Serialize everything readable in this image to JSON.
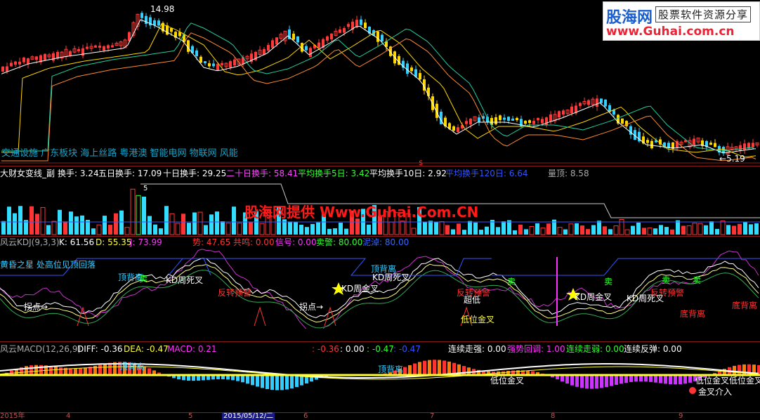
{
  "colors": {
    "up": "#ff3333",
    "down": "#33ccff",
    "gold": "#ffd700",
    "kline_up": "#ff4040",
    "kline_down": "#40e0ff",
    "magenta": "#ff33ff",
    "green": "#33ff33",
    "blue": "#3355ff",
    "yellow": "#ffff33",
    "cyan": "#33ffff"
  },
  "main": {
    "high_label": "14.98",
    "low_label": "5.19",
    "concepts": "交通设施 广东板块 海上丝路 粤港澳 智能电网 物联网 风能",
    "divider_mark": "$"
  },
  "vol": {
    "header": [
      {
        "text": "大财女变线_副",
        "color": "#ffffff"
      },
      {
        "text": "换手: 3.24",
        "color": "#ffffff"
      },
      {
        "text": "五日换手: 17.09",
        "color": "#ffffff"
      },
      {
        "text": "十日换手: 29.25",
        "color": "#ffffff"
      },
      {
        "text": "二十日换手: 58.41",
        "color": "#ff44ff"
      },
      {
        "text": "平均换手5日: 3.42",
        "color": "#33ff33"
      },
      {
        "text": "平均换手10日: 2.92",
        "color": "#ffffff"
      },
      {
        "text": "平均换手120日: 6.64",
        "color": "#3355ff"
      },
      {
        "text": "量顶: 8.58",
        "color": "#aaaaaa"
      }
    ],
    "marker": "5"
  },
  "watermark": "股海网提供 Www.Guhai.Com.CN",
  "logo": {
    "main": "股海网",
    "sub": "股票软件资源分享",
    "url": "www.Guhai.com.cn"
  },
  "kdj": {
    "header": [
      {
        "text": "风云KDJ(9,3,3)",
        "color": "#aaaaaa"
      },
      {
        "text": "K: 61.56",
        "color": "#ffffff"
      },
      {
        "text": "D: 55.35",
        "color": "#ffff33"
      },
      {
        "text": "J: 73.99",
        "color": "#ff33ff"
      },
      {
        "text": "势: 47.65",
        "color": "#ff3333"
      },
      {
        "text": "共鸣: 0.00",
        "color": "#ff3333"
      },
      {
        "text": "信号: 0.00",
        "color": "#ff33ff"
      },
      {
        "text": "卖警: 80.00",
        "color": "#33ff33"
      },
      {
        "text": "泥淖: 80.00",
        "color": "#3366ff"
      }
    ],
    "annotations": [
      {
        "text": "黄昏之星 处高位见顶回落",
        "color": "#33ccff"
      },
      {
        "text": "顶背离",
        "color": "#33ccff"
      },
      {
        "text": "KD周死叉",
        "color": "#ffffff"
      },
      {
        "text": "反转预警",
        "color": "#ff3333"
      },
      {
        "text": "拐点→",
        "color": "#ffffff"
      },
      {
        "text": "卖",
        "color": "#33ff33"
      },
      {
        "text": "顶背离",
        "color": "#33ccff"
      },
      {
        "text": "KD周死叉",
        "color": "#ffffff"
      },
      {
        "text": "KD周金叉",
        "color": "#ffffff"
      },
      {
        "text": "拐点→",
        "color": "#ffffff"
      },
      {
        "text": "超低",
        "color": "#ffffff"
      },
      {
        "text": "反转预警",
        "color": "#ff3333"
      },
      {
        "text": "低位金叉",
        "color": "#ffff33"
      },
      {
        "text": "卖",
        "color": "#33ff33"
      },
      {
        "text": "KD周金叉",
        "color": "#ffffff"
      },
      {
        "text": "卖",
        "color": "#33ff33"
      },
      {
        "text": "KD周死叉",
        "color": "#ffffff"
      },
      {
        "text": "反转预警",
        "color": "#ff3333"
      },
      {
        "text": "卖",
        "color": "#33ff33"
      },
      {
        "text": "卖",
        "color": "#33ff33"
      },
      {
        "text": "底背离",
        "color": "#ff3333"
      },
      {
        "text": "底背离",
        "color": "#ff3333"
      }
    ]
  },
  "macd": {
    "header": [
      {
        "text": "风云MACD(12,26,9)",
        "color": "#aaaaaa"
      },
      {
        "text": "DIFF: -0.36",
        "color": "#ffffff"
      },
      {
        "text": "DEA: -0.47",
        "color": "#ffff33"
      },
      {
        "text": "MACD: 0.21",
        "color": "#ff33ff"
      },
      {
        "text": ": -0.36",
        "color": "#ff3333"
      },
      {
        "text": ": 0.00",
        "color": "#ffffff"
      },
      {
        "text": ": -0.47",
        "color": "#33ff33"
      },
      {
        "text": ": -0.47",
        "color": "#3355ff"
      },
      {
        "text": "连续走强: 0.00",
        "color": "#ffffff"
      },
      {
        "text": "强势回调: 1.00",
        "color": "#ff33ff"
      },
      {
        "text": "连续走弱: 0.00",
        "color": "#33ff33"
      },
      {
        "text": "连续反弹: 0.00",
        "color": "#ffffff"
      }
    ],
    "annotations": [
      {
        "text": "顶背离",
        "color": "#33ccff"
      },
      {
        "text": "顶背离",
        "color": "#33ccff"
      },
      {
        "text": "低位金叉",
        "color": "#ffffff"
      },
      {
        "text": "低位金叉低位金叉",
        "color": "#ffffff"
      },
      {
        "text": "金叉介入",
        "color": "#ffffff"
      }
    ]
  },
  "status_bar": [
    {
      "text": "2015年"
    },
    {
      "text": "4"
    },
    {
      "text": "5"
    },
    {
      "text": "2015/05/12/二"
    },
    {
      "text": "6"
    },
    {
      "text": "7"
    },
    {
      "text": "8"
    },
    {
      "text": "9"
    }
  ]
}
